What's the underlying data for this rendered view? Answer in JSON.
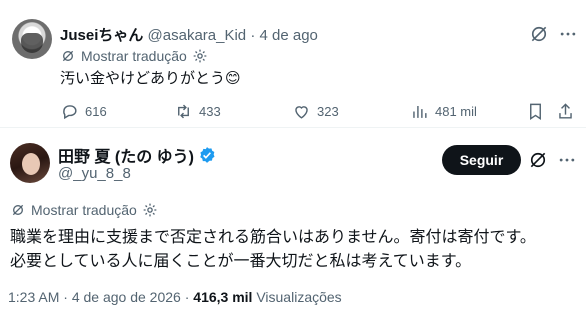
{
  "reply": {
    "display_name": "Juseiちゃん",
    "handle": "@asakara_Kid",
    "separator": "·",
    "date": "4 de ago",
    "translate": "Mostrar tradução",
    "text": "汚い金やけどありがとう",
    "emoji": "😊",
    "actions": {
      "replies": "616",
      "reposts": "433",
      "likes": "323",
      "views": "481 mil"
    }
  },
  "main": {
    "display_name": "田野 夏 (たの ゆう)",
    "handle": "@_yu_8_8",
    "follow": "Seguir",
    "translate": "Mostrar tradução",
    "text_line1": "職業を理由に支援まで否定される筋合いはありません。寄付は寄付です。",
    "text_line2": "必要としている人に届くことが一番大切だと私は考えています。",
    "time": "1:23 AM",
    "separator": "·",
    "date": "4 de ago de 2026",
    "separator2": "·",
    "views": "416,3 mil",
    "views_label": "Visualizações"
  },
  "colors": {
    "accent": "#1d9bf0",
    "text": "#0f1419",
    "muted": "#536471",
    "verified": "#1d9bf0"
  }
}
